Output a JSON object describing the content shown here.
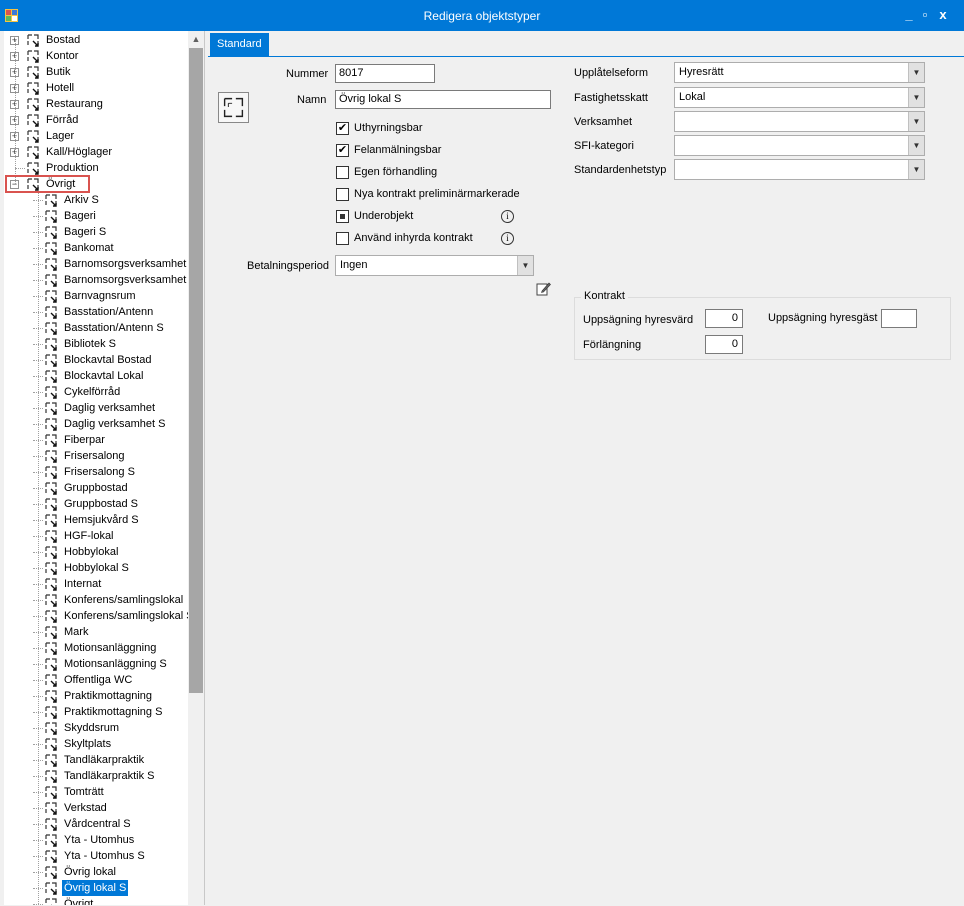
{
  "window": {
    "title": "Redigera objektstyper",
    "min_label": "_",
    "max_label": "▫",
    "close_label": "x"
  },
  "tree": {
    "top_items": [
      "Bostad",
      "Kontor",
      "Butik",
      "Hotell",
      "Restaurang",
      "Förråd",
      "Lager",
      "Kall/Höglager",
      "Produktion",
      "Övrigt"
    ],
    "expanded_item": "Övrigt",
    "children": [
      "Arkiv S",
      "Bageri",
      "Bageri S",
      "Bankomat",
      "Barnomsorgsverksamhet",
      "Barnomsorgsverksamhet S",
      "Barnvagnsrum",
      "Basstation/Antenn",
      "Basstation/Antenn S",
      "Bibliotek S",
      "Blockavtal Bostad",
      "Blockavtal Lokal",
      "Cykelförråd",
      "Daglig verksamhet",
      "Daglig verksamhet S",
      "Fiberpar",
      "Frisersalong",
      "Frisersalong S",
      "Gruppbostad",
      "Gruppbostad S",
      "Hemsjukvård S",
      "HGF-lokal",
      "Hobbylokal",
      "Hobbylokal S",
      "Internat",
      "Konferens/samlingslokal",
      "Konferens/samlingslokal S",
      "Mark",
      "Motionsanläggning",
      "Motionsanläggning S",
      "Offentliga WC",
      "Praktikmottagning",
      "Praktikmottagning S",
      "Skyddsrum",
      "Skyltplats",
      "Tandläkarpraktik",
      "Tandläkarpraktik S",
      "Tomträtt",
      "Verkstad",
      "Vårdcentral S",
      "Yta - Utomhus",
      "Yta - Utomhus S",
      "Övrig lokal",
      "Övrig lokal S",
      "Övrigt"
    ],
    "selected_child": "Övrig lokal S"
  },
  "tabs": {
    "standard": "Standard"
  },
  "form": {
    "nummer_label": "Nummer",
    "nummer_value": "8017",
    "namn_label": "Namn",
    "namn_value": "Övrig lokal S",
    "checkboxes": [
      {
        "label": "Uthyrningsbar",
        "checked": true
      },
      {
        "label": "Felanmälningsbar",
        "checked": true
      },
      {
        "label": "Egen förhandling",
        "checked": false
      },
      {
        "label": "Nya kontrakt preliminärmarkerade",
        "checked": false
      },
      {
        "label": "Underobjekt",
        "checked": "indeterminate"
      },
      {
        "label": "Använd inhyrda kontrakt",
        "checked": false
      }
    ],
    "check_mark": "✔",
    "betalningsperiod_label": "Betalningsperiod",
    "betalningsperiod_value": "Ingen",
    "upplatelseform_label": "Upplåtelseform",
    "upplatelseform_value": "Hyresrätt",
    "fastighetsskatt_label": "Fastighetsskatt",
    "fastighetsskatt_value": "Lokal",
    "verksamhet_label": "Verksamhet",
    "verksamhet_value": "",
    "sfi_label": "SFI-kategori",
    "sfi_value": "",
    "standardenhetstyp_label": "Standardenhetstyp",
    "standardenhetstyp_value": "",
    "info_glyph": "i"
  },
  "kontrakt": {
    "title": "Kontrakt",
    "uppsagning_hyresvard_label": "Uppsägning hyresvärd",
    "uppsagning_hyresvard_value": "0",
    "uppsagning_hyresgast_label": "Uppsägning hyresgäst",
    "uppsagning_hyresgast_value": "",
    "forlangning_label": "Förlängning",
    "forlangning_value": "0"
  }
}
